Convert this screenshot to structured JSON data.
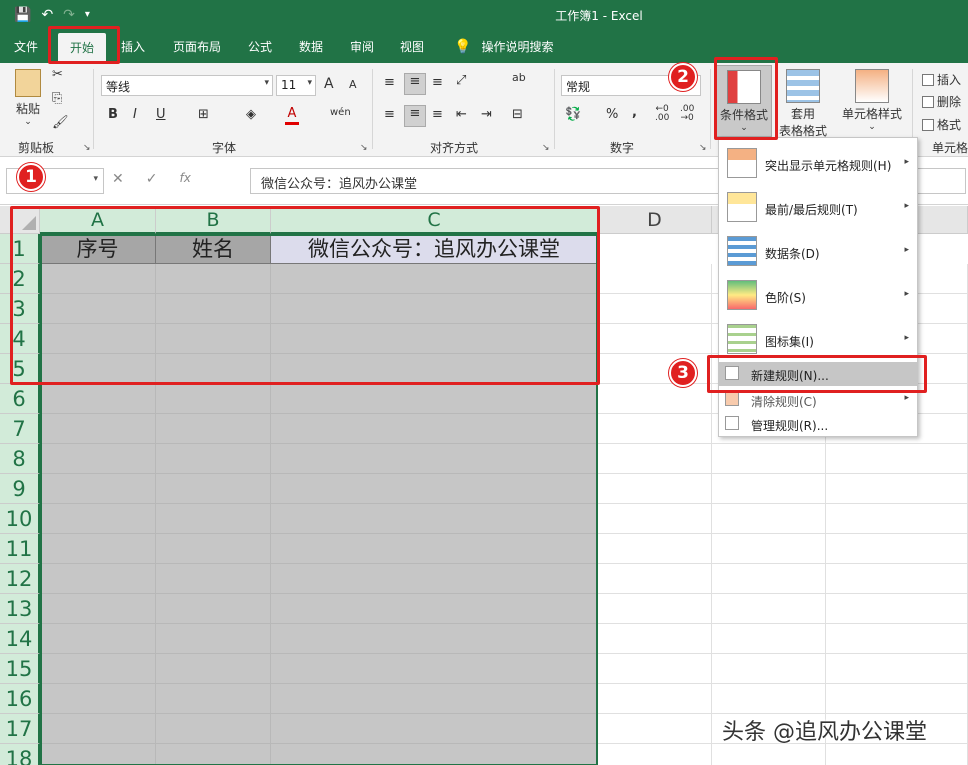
{
  "titlebar": {
    "save_icon": "save-icon",
    "undo_icon": "undo-icon",
    "redo_icon": "redo-icon",
    "customize_icon": "customize-icon",
    "title": "工作簿1  -  Excel"
  },
  "tabs": [
    {
      "label": "文件"
    },
    {
      "label": "开始"
    },
    {
      "label": "插入"
    },
    {
      "label": "页面布局"
    },
    {
      "label": "公式"
    },
    {
      "label": "数据"
    },
    {
      "label": "审阅"
    },
    {
      "label": "视图"
    }
  ],
  "tell_me": {
    "icon": "lightbulb-icon",
    "label": "操作说明搜索"
  },
  "ribbon": {
    "clipboard": {
      "paste_label": "粘贴",
      "group_label": "剪贴板"
    },
    "font": {
      "font_name": "等线",
      "font_size": "11",
      "bold": "B",
      "italic": "I",
      "underline": "U",
      "group_label": "字体",
      "grow": "A",
      "shrink": "A",
      "phonetic": "wén"
    },
    "alignment": {
      "group_label": "对齐方式",
      "wrap": "ab"
    },
    "number": {
      "format": "常规",
      "group_label": "数字",
      "percent": "%",
      "comma": ","
    },
    "styles": {
      "cond_format": "条件格式",
      "table_format_1": "套用",
      "table_format_2": "表格格式",
      "cell_style": "单元格样式"
    },
    "cells": {
      "insert": "插入",
      "delete": "删除",
      "format": "格式",
      "group_label": "单元格"
    }
  },
  "formula_bar": {
    "name_box": "",
    "cancel": "✕",
    "enter": "✓",
    "fx": "fx",
    "content": "微信公众号：追风办公课堂"
  },
  "grid": {
    "columns": [
      "A",
      "B",
      "C",
      "D"
    ],
    "rows": [
      "1",
      "2",
      "3",
      "4",
      "5",
      "6",
      "7",
      "8",
      "9",
      "10",
      "11",
      "12",
      "13",
      "14",
      "15",
      "16",
      "17",
      "18"
    ],
    "header_cells": [
      "序号",
      "姓名",
      "微信公众号：追风办公课堂"
    ]
  },
  "menu": {
    "items": [
      {
        "label": "突出显示单元格规则(H)",
        "icon": "highlight-rules-icon"
      },
      {
        "label": "最前/最后规则(T)",
        "icon": "top-bottom-rules-icon"
      },
      {
        "label": "数据条(D)",
        "icon": "data-bars-icon"
      },
      {
        "label": "色阶(S)",
        "icon": "color-scales-icon"
      },
      {
        "label": "图标集(I)",
        "icon": "icon-sets-icon"
      },
      {
        "label": "新建规则(N)...",
        "icon": "new-rule-icon"
      },
      {
        "label": "清除规则(C)",
        "icon": "clear-rules-icon"
      },
      {
        "label": "管理规则(R)...",
        "icon": "manage-rules-icon"
      }
    ]
  },
  "annotations": {
    "badge1": "1",
    "badge2": "2",
    "badge3": "3"
  },
  "watermark": "头条 @追风办公课堂"
}
